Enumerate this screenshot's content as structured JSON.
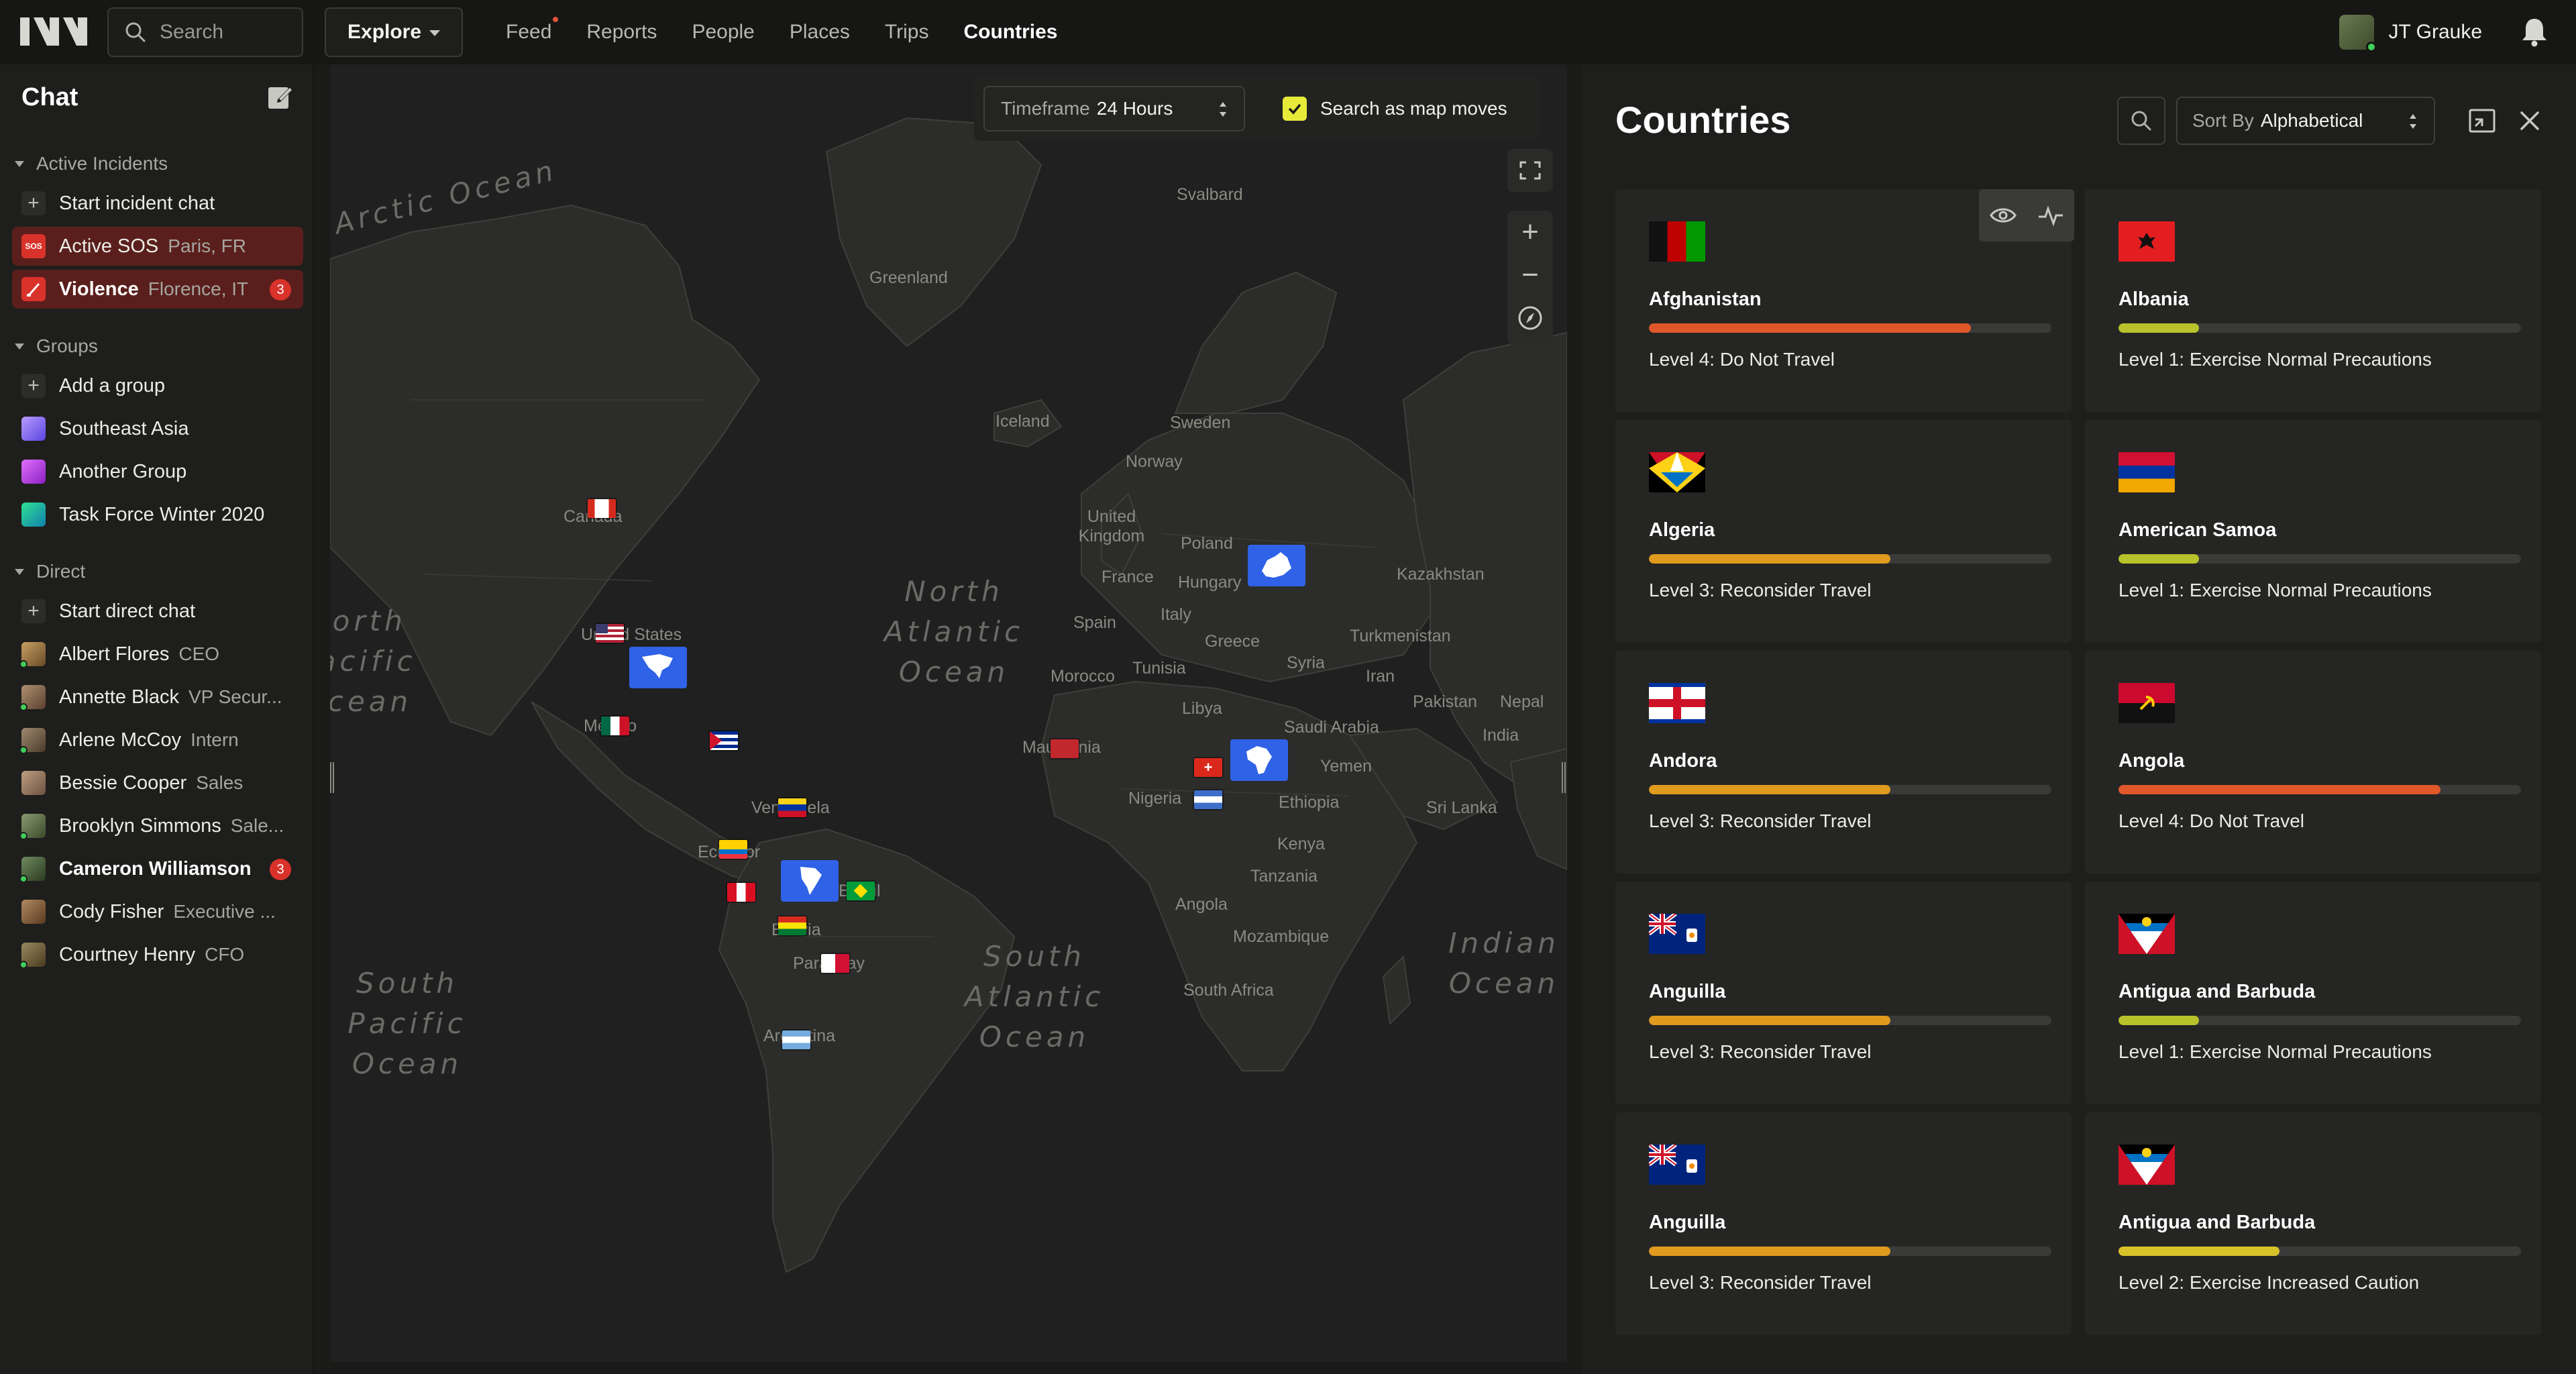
{
  "topbar": {
    "search_label": "Search",
    "explore_label": "Explore",
    "nav": [
      {
        "label": "Feed",
        "has_dot": true
      },
      {
        "label": "Reports"
      },
      {
        "label": "People"
      },
      {
        "label": "Places"
      },
      {
        "label": "Trips"
      },
      {
        "label": "Countries",
        "active": true
      }
    ],
    "user_name": "JT Grauke"
  },
  "sidebar": {
    "title": "Chat",
    "sections": {
      "incidents": "Active Incidents",
      "groups": "Groups",
      "direct": "Direct"
    },
    "incidents": [
      {
        "label": "Start incident chat"
      },
      {
        "label": "Active SOS",
        "sub": "Paris, FR",
        "icon_text": "SOS"
      },
      {
        "label": "Violence",
        "sub": "Florence, IT",
        "badge": "3"
      }
    ],
    "groups": [
      {
        "label": "Add a group"
      },
      {
        "label": "Southeast Asia",
        "color": "#8a6cf0"
      },
      {
        "label": "Another Group",
        "color": "#c040e0"
      },
      {
        "label": "Task Force Winter 2020",
        "color": "#20c080"
      }
    ],
    "direct": [
      {
        "label": "Start direct chat"
      },
      {
        "label": "Albert Flores",
        "sub": "CEO"
      },
      {
        "label": "Annette Black",
        "sub": "VP Secur..."
      },
      {
        "label": "Arlene McCoy",
        "sub": "Intern"
      },
      {
        "label": "Bessie Cooper",
        "sub": "Sales"
      },
      {
        "label": "Brooklyn Simmons",
        "sub": "Sale..."
      },
      {
        "label": "Cameron Williamson",
        "sub": "",
        "badge": "3"
      },
      {
        "label": "Cody Fisher",
        "sub": "Executive ..."
      },
      {
        "label": "Courtney Henry",
        "sub": "CFO"
      }
    ]
  },
  "map": {
    "timeframe_label": "Timeframe",
    "timeframe_value": "24 Hours",
    "search_as_moves": "Search as map moves",
    "oceans": {
      "arctic": "Arctic Ocean",
      "north_atlantic": "North Atlantic Ocean",
      "south_atlantic": "South Atlantic Ocean",
      "south_pacific": "South Pacific Ocean",
      "north_pacific": "North Pacific Ocean",
      "indian": "Indian Ocean"
    },
    "places": {
      "greenland": "Greenland",
      "svalbard": "Svalbard",
      "iceland": "Iceland",
      "sweden": "Sweden",
      "norway": "Norway",
      "uk": "United Kingdom",
      "poland": "Poland",
      "france": "France",
      "hungary": "Hungary",
      "kazakhstan": "Kazakhstan",
      "spain": "Spain",
      "italy": "Italy",
      "turkmenistan": "Turkmenistan",
      "greece": "Greece",
      "morocco": "Morocco",
      "tunisia": "Tunisia",
      "syria": "Syria",
      "iran": "Iran",
      "libya": "Libya",
      "pakistan": "Pakistan",
      "nepal": "Nepal",
      "saudi": "Saudi Arabia",
      "india": "India",
      "mauritania": "Mauritania",
      "yemen": "Yemen",
      "ethiopia": "Ethiopia",
      "nigeria": "Nigeria",
      "kenya": "Kenya",
      "srilanka": "Sri Lanka",
      "tanzania": "Tanzania",
      "angola": "Angola",
      "mozambique": "Mozambique",
      "southafrica": "South Africa",
      "canada": "Canada",
      "us": "United States",
      "mexico": "Mexico",
      "venezuela": "Venezuela",
      "ecuador": "Ecuador",
      "brazil": "Brazil",
      "bolivia": "Bolivia",
      "paraguay": "Paraguay",
      "argentina": "Argentina"
    }
  },
  "panel": {
    "title": "Countries",
    "sort_label": "Sort By",
    "sort_value": "Alphabetical",
    "countries": [
      {
        "name": "Afghanistan",
        "level": "Level 4: Do Not Travel",
        "pct": 80,
        "color": "#e0572a"
      },
      {
        "name": "Albania",
        "level": "Level 1: Exercise Normal Precautions",
        "pct": 20,
        "color": "#b8c22a"
      },
      {
        "name": "Algeria",
        "level": "Level 3: Reconsider Travel",
        "pct": 60,
        "color": "#e09a1e"
      },
      {
        "name": "American Samoa",
        "level": "Level 1: Exercise Normal Precautions",
        "pct": 20,
        "color": "#b8c22a"
      },
      {
        "name": "Andora",
        "level": "Level 3: Reconsider Travel",
        "pct": 60,
        "color": "#e09a1e"
      },
      {
        "name": "Angola",
        "level": "Level 4: Do Not Travel",
        "pct": 80,
        "color": "#e0572a"
      },
      {
        "name": "Anguilla",
        "level": "Level 3: Reconsider Travel",
        "pct": 60,
        "color": "#e09a1e"
      },
      {
        "name": "Antigua and Barbuda",
        "level": "Level 1: Exercise Normal Precautions",
        "pct": 20,
        "color": "#b8c22a"
      },
      {
        "name": "Anguilla",
        "level": "Level 3: Reconsider Travel",
        "pct": 60,
        "color": "#e09a1e"
      },
      {
        "name": "Antigua and Barbuda",
        "level": "Level 2: Exercise Increased Caution",
        "pct": 40,
        "color": "#d8c22a"
      }
    ]
  }
}
